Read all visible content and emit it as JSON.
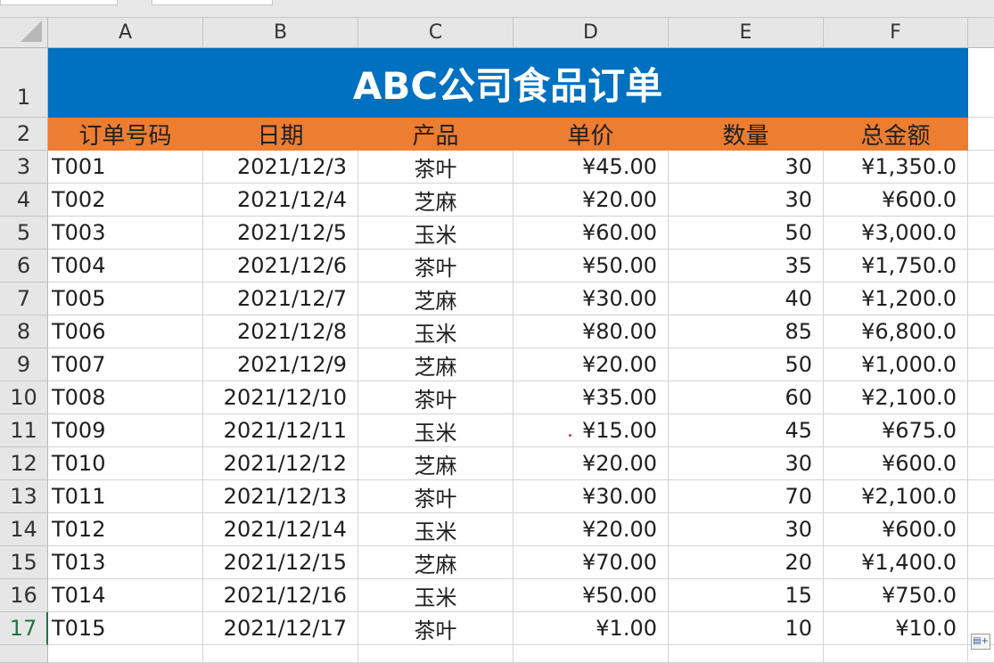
{
  "spreadsheet": {
    "columns": [
      "A",
      "B",
      "C",
      "D",
      "E",
      "F"
    ],
    "title": "ABC公司食品订单",
    "header_row_number": 2,
    "title_row_number": 1,
    "headers": [
      "订单号码",
      "日期",
      "产品",
      "单价",
      "数量",
      "总金额"
    ],
    "rows": [
      {
        "num": "3",
        "id": "T001",
        "date": "2021/12/3",
        "product": "茶叶",
        "price": "¥45.00",
        "qty": "30",
        "total": "¥1,350.0"
      },
      {
        "num": "4",
        "id": "T002",
        "date": "2021/12/4",
        "product": "芝麻",
        "price": "¥20.00",
        "qty": "30",
        "total": "¥600.0"
      },
      {
        "num": "5",
        "id": "T003",
        "date": "2021/12/5",
        "product": "玉米",
        "price": "¥60.00",
        "qty": "50",
        "total": "¥3,000.0"
      },
      {
        "num": "6",
        "id": "T004",
        "date": "2021/12/6",
        "product": "茶叶",
        "price": "¥50.00",
        "qty": "35",
        "total": "¥1,750.0"
      },
      {
        "num": "7",
        "id": "T005",
        "date": "2021/12/7",
        "product": "芝麻",
        "price": "¥30.00",
        "qty": "40",
        "total": "¥1,200.0"
      },
      {
        "num": "8",
        "id": "T006",
        "date": "2021/12/8",
        "product": "玉米",
        "price": "¥80.00",
        "qty": "85",
        "total": "¥6,800.0"
      },
      {
        "num": "9",
        "id": "T007",
        "date": "2021/12/9",
        "product": "芝麻",
        "price": "¥20.00",
        "qty": "50",
        "total": "¥1,000.0"
      },
      {
        "num": "10",
        "id": "T008",
        "date": "2021/12/10",
        "product": "茶叶",
        "price": "¥35.00",
        "qty": "60",
        "total": "¥2,100.0"
      },
      {
        "num": "11",
        "id": "T009",
        "date": "2021/12/11",
        "product": "玉米",
        "price": "¥15.00",
        "qty": "45",
        "total": "¥675.0"
      },
      {
        "num": "12",
        "id": "T010",
        "date": "2021/12/12",
        "product": "芝麻",
        "price": "¥20.00",
        "qty": "30",
        "total": "¥600.0"
      },
      {
        "num": "13",
        "id": "T011",
        "date": "2021/12/13",
        "product": "茶叶",
        "price": "¥30.00",
        "qty": "70",
        "total": "¥2,100.0"
      },
      {
        "num": "14",
        "id": "T012",
        "date": "2021/12/14",
        "product": "玉米",
        "price": "¥20.00",
        "qty": "30",
        "total": "¥600.0"
      },
      {
        "num": "15",
        "id": "T013",
        "date": "2021/12/15",
        "product": "芝麻",
        "price": "¥70.00",
        "qty": "20",
        "total": "¥1,400.0"
      },
      {
        "num": "16",
        "id": "T014",
        "date": "2021/12/16",
        "product": "玉米",
        "price": "¥50.00",
        "qty": "15",
        "total": "¥750.0"
      },
      {
        "num": "17",
        "id": "T015",
        "date": "2021/12/17",
        "product": "茶叶",
        "price": "¥1.00",
        "qty": "10",
        "total": "¥10.0"
      }
    ],
    "active_row": "17"
  },
  "colors": {
    "title_bg": "#0070c0",
    "header_bg": "#ed7d31",
    "gridline": "#d4d4d4",
    "active_header": "#217346"
  },
  "icons": {
    "corner": "select-all-triangle-icon",
    "quick_analysis": "quick-analysis-icon"
  }
}
